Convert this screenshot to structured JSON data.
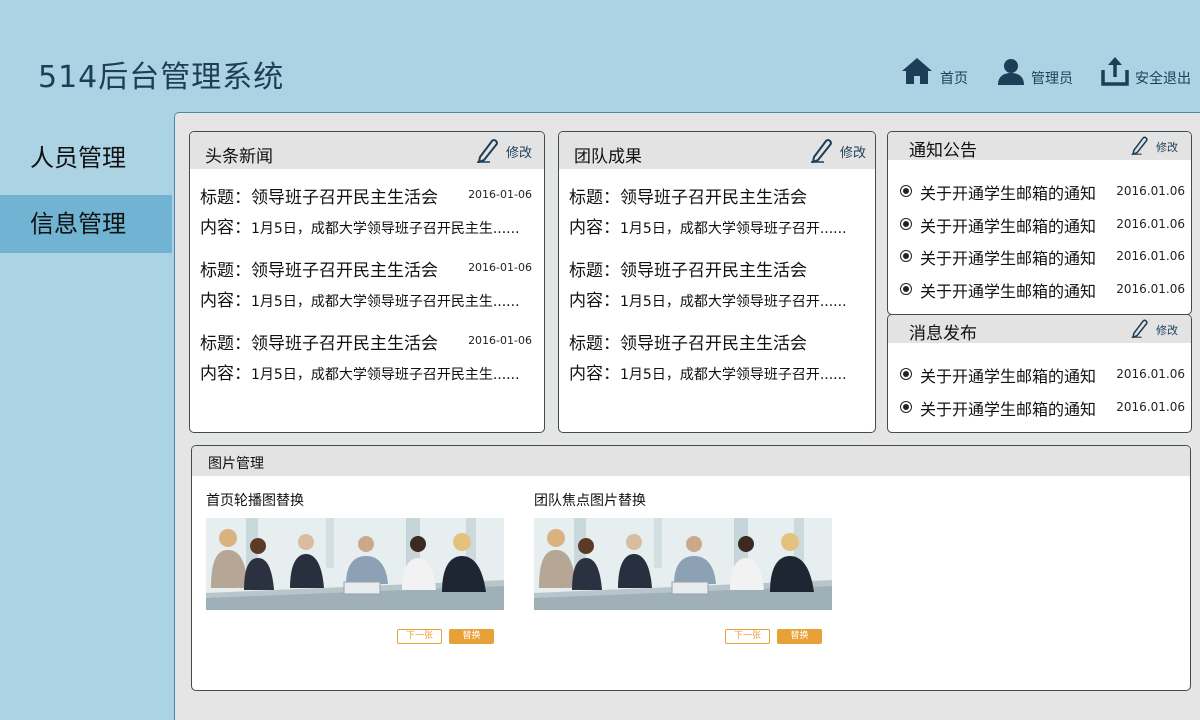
{
  "app": {
    "title": "514后台管理系统"
  },
  "top_nav": [
    {
      "label": "首页",
      "icon": "home-icon"
    },
    {
      "label": "管理员",
      "icon": "user-icon"
    },
    {
      "label": "安全退出",
      "icon": "logout-icon"
    }
  ],
  "sidebar": {
    "items": [
      {
        "label": "人员管理",
        "active": false
      },
      {
        "label": "信息管理",
        "active": true
      }
    ]
  },
  "edit_label": "修改",
  "headline_news": {
    "title": "头条新闻",
    "items": [
      {
        "title_key": "标题：",
        "title": "领导班子召开民主生活会",
        "date": "2016-01-06",
        "content_key": "内容：",
        "content": "1月5日，成都大学领导班子召开民主生......"
      },
      {
        "title_key": "标题：",
        "title": "领导班子召开民主生活会",
        "date": "2016-01-06",
        "content_key": "内容：",
        "content": "1月5日，成都大学领导班子召开民主生......"
      },
      {
        "title_key": "标题：",
        "title": "领导班子召开民主生活会",
        "date": "2016-01-06",
        "content_key": "内容：",
        "content": "1月5日，成都大学领导班子召开民主生......"
      }
    ]
  },
  "team_results": {
    "title": "团队成果",
    "items": [
      {
        "title_key": "标题：",
        "title": "领导班子召开民主生活会",
        "content_key": "内容：",
        "content": "1月5日，成都大学领导班子召开......"
      },
      {
        "title_key": "标题：",
        "title": "领导班子召开民主生活会",
        "content_key": "内容：",
        "content": "1月5日，成都大学领导班子召开......"
      },
      {
        "title_key": "标题：",
        "title": "领导班子召开民主生活会",
        "content_key": "内容：",
        "content": "1月5日，成都大学领导班子召开......"
      }
    ]
  },
  "notices": {
    "title": "通知公告",
    "items": [
      {
        "text": "关于开通学生邮箱的通知",
        "date": "2016.01.06"
      },
      {
        "text": "关于开通学生邮箱的通知",
        "date": "2016.01.06"
      },
      {
        "text": "关于开通学生邮箱的通知",
        "date": "2016.01.06"
      },
      {
        "text": "关于开通学生邮箱的通知",
        "date": "2016.01.06"
      }
    ]
  },
  "messages": {
    "title": "消息发布",
    "items": [
      {
        "text": "关于开通学生邮箱的通知",
        "date": "2016.01.06"
      },
      {
        "text": "关于开通学生邮箱的通知",
        "date": "2016.01.06"
      }
    ]
  },
  "image_management": {
    "title": "图片管理",
    "blocks": [
      {
        "label": "首页轮播图替换",
        "next_label": "下一张",
        "replace_label": "替换"
      },
      {
        "label": "团队焦点图片替换",
        "next_label": "下一张",
        "replace_label": "替换"
      }
    ]
  },
  "colors": {
    "background": "#acd3e4",
    "sidebar_active": "#70b3d3",
    "title_text": "#1d3e57",
    "accent_orange": "#e8a038",
    "panel_header": "#e3e3e3"
  }
}
